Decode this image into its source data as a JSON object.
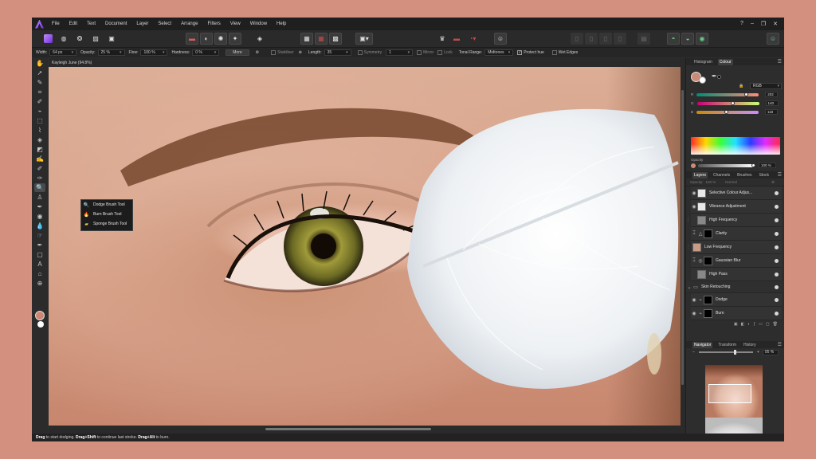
{
  "menubar": {
    "items": [
      "File",
      "Edit",
      "Text",
      "Document",
      "Layer",
      "Select",
      "Arrange",
      "Filters",
      "View",
      "Window",
      "Help"
    ]
  },
  "context_toolbar": {
    "width_label": "Width:",
    "width_value": "64 px",
    "opacity_label": "Opacity:",
    "opacity_value": "25 %",
    "flow_label": "Flow:",
    "flow_value": "100 %",
    "hardness_label": "Hardness:",
    "hardness_value": "0 %",
    "more_label": "More",
    "stabiliser_label": "Stabiliser",
    "length_label": "Length:",
    "length_value": "35",
    "symmetry_label": "Symmetry",
    "symmetry_value": "1",
    "mirror_label": "Mirror",
    "lock_label": "Lock",
    "tonal_range_label": "Tonal Range:",
    "tonal_range_value": "Midtones",
    "protect_hue_label": "Protect hue",
    "wet_edges_label": "Wet Edges"
  },
  "document": {
    "title": "Kayleigh June (94.8%)"
  },
  "flyout": {
    "items": [
      {
        "label": "Dodge Brush Tool",
        "icon": "dodge-icon"
      },
      {
        "label": "Burn Brush Tool",
        "icon": "burn-icon"
      },
      {
        "label": "Sponge Brush Tool",
        "icon": "sponge-icon"
      }
    ]
  },
  "color_panel": {
    "tabs": [
      "Histogram",
      "Colour"
    ],
    "selected_tab": "Colour",
    "model": "RGB",
    "r_label": "R",
    "r_value": "202",
    "g_label": "G",
    "g_value": "140",
    "b_label": "B",
    "b_value": "118",
    "opacity_label": "Opacity",
    "opacity_value": "100 %",
    "current_colour": "#ca8c76"
  },
  "layers_panel": {
    "tabs": [
      "Layers",
      "Channels",
      "Brushes",
      "Stock"
    ],
    "selected_tab": "Layers",
    "opacity_label": "Opacity:",
    "opacity_value": "100 %",
    "blend_mode": "Normal",
    "layers": [
      {
        "name": "Selective Colour Adjus...",
        "icon": "selective-colour-icon"
      },
      {
        "name": "Vibrance Adjustment",
        "icon": "vibrance-icon"
      },
      {
        "name": "High Frequency",
        "icon": "pixel-layer-icon"
      },
      {
        "name": "Clarity",
        "icon": "clarity-icon"
      },
      {
        "name": "Low Frequency",
        "icon": "pixel-layer-icon"
      },
      {
        "name": "Gaussian Blur",
        "icon": "blur-icon"
      },
      {
        "name": "High Pass",
        "icon": "pixel-layer-icon"
      },
      {
        "name": "Skin Retouching",
        "icon": "group-folder-icon"
      },
      {
        "name": "Dodge",
        "icon": "curves-icon"
      },
      {
        "name": "Burn",
        "icon": "curves-icon"
      }
    ]
  },
  "navigator_panel": {
    "tabs": [
      "Navigator",
      "Transform",
      "History"
    ],
    "selected_tab": "Navigator",
    "zoom_value": "95 %"
  },
  "statusbar": {
    "drag_1": "Drag",
    "text_1": " to start dodging. ",
    "drag_2": "Drag+Shift",
    "text_2": " to continue last stroke. ",
    "drag_3": "Drag+Alt",
    "text_3": " to burn."
  }
}
